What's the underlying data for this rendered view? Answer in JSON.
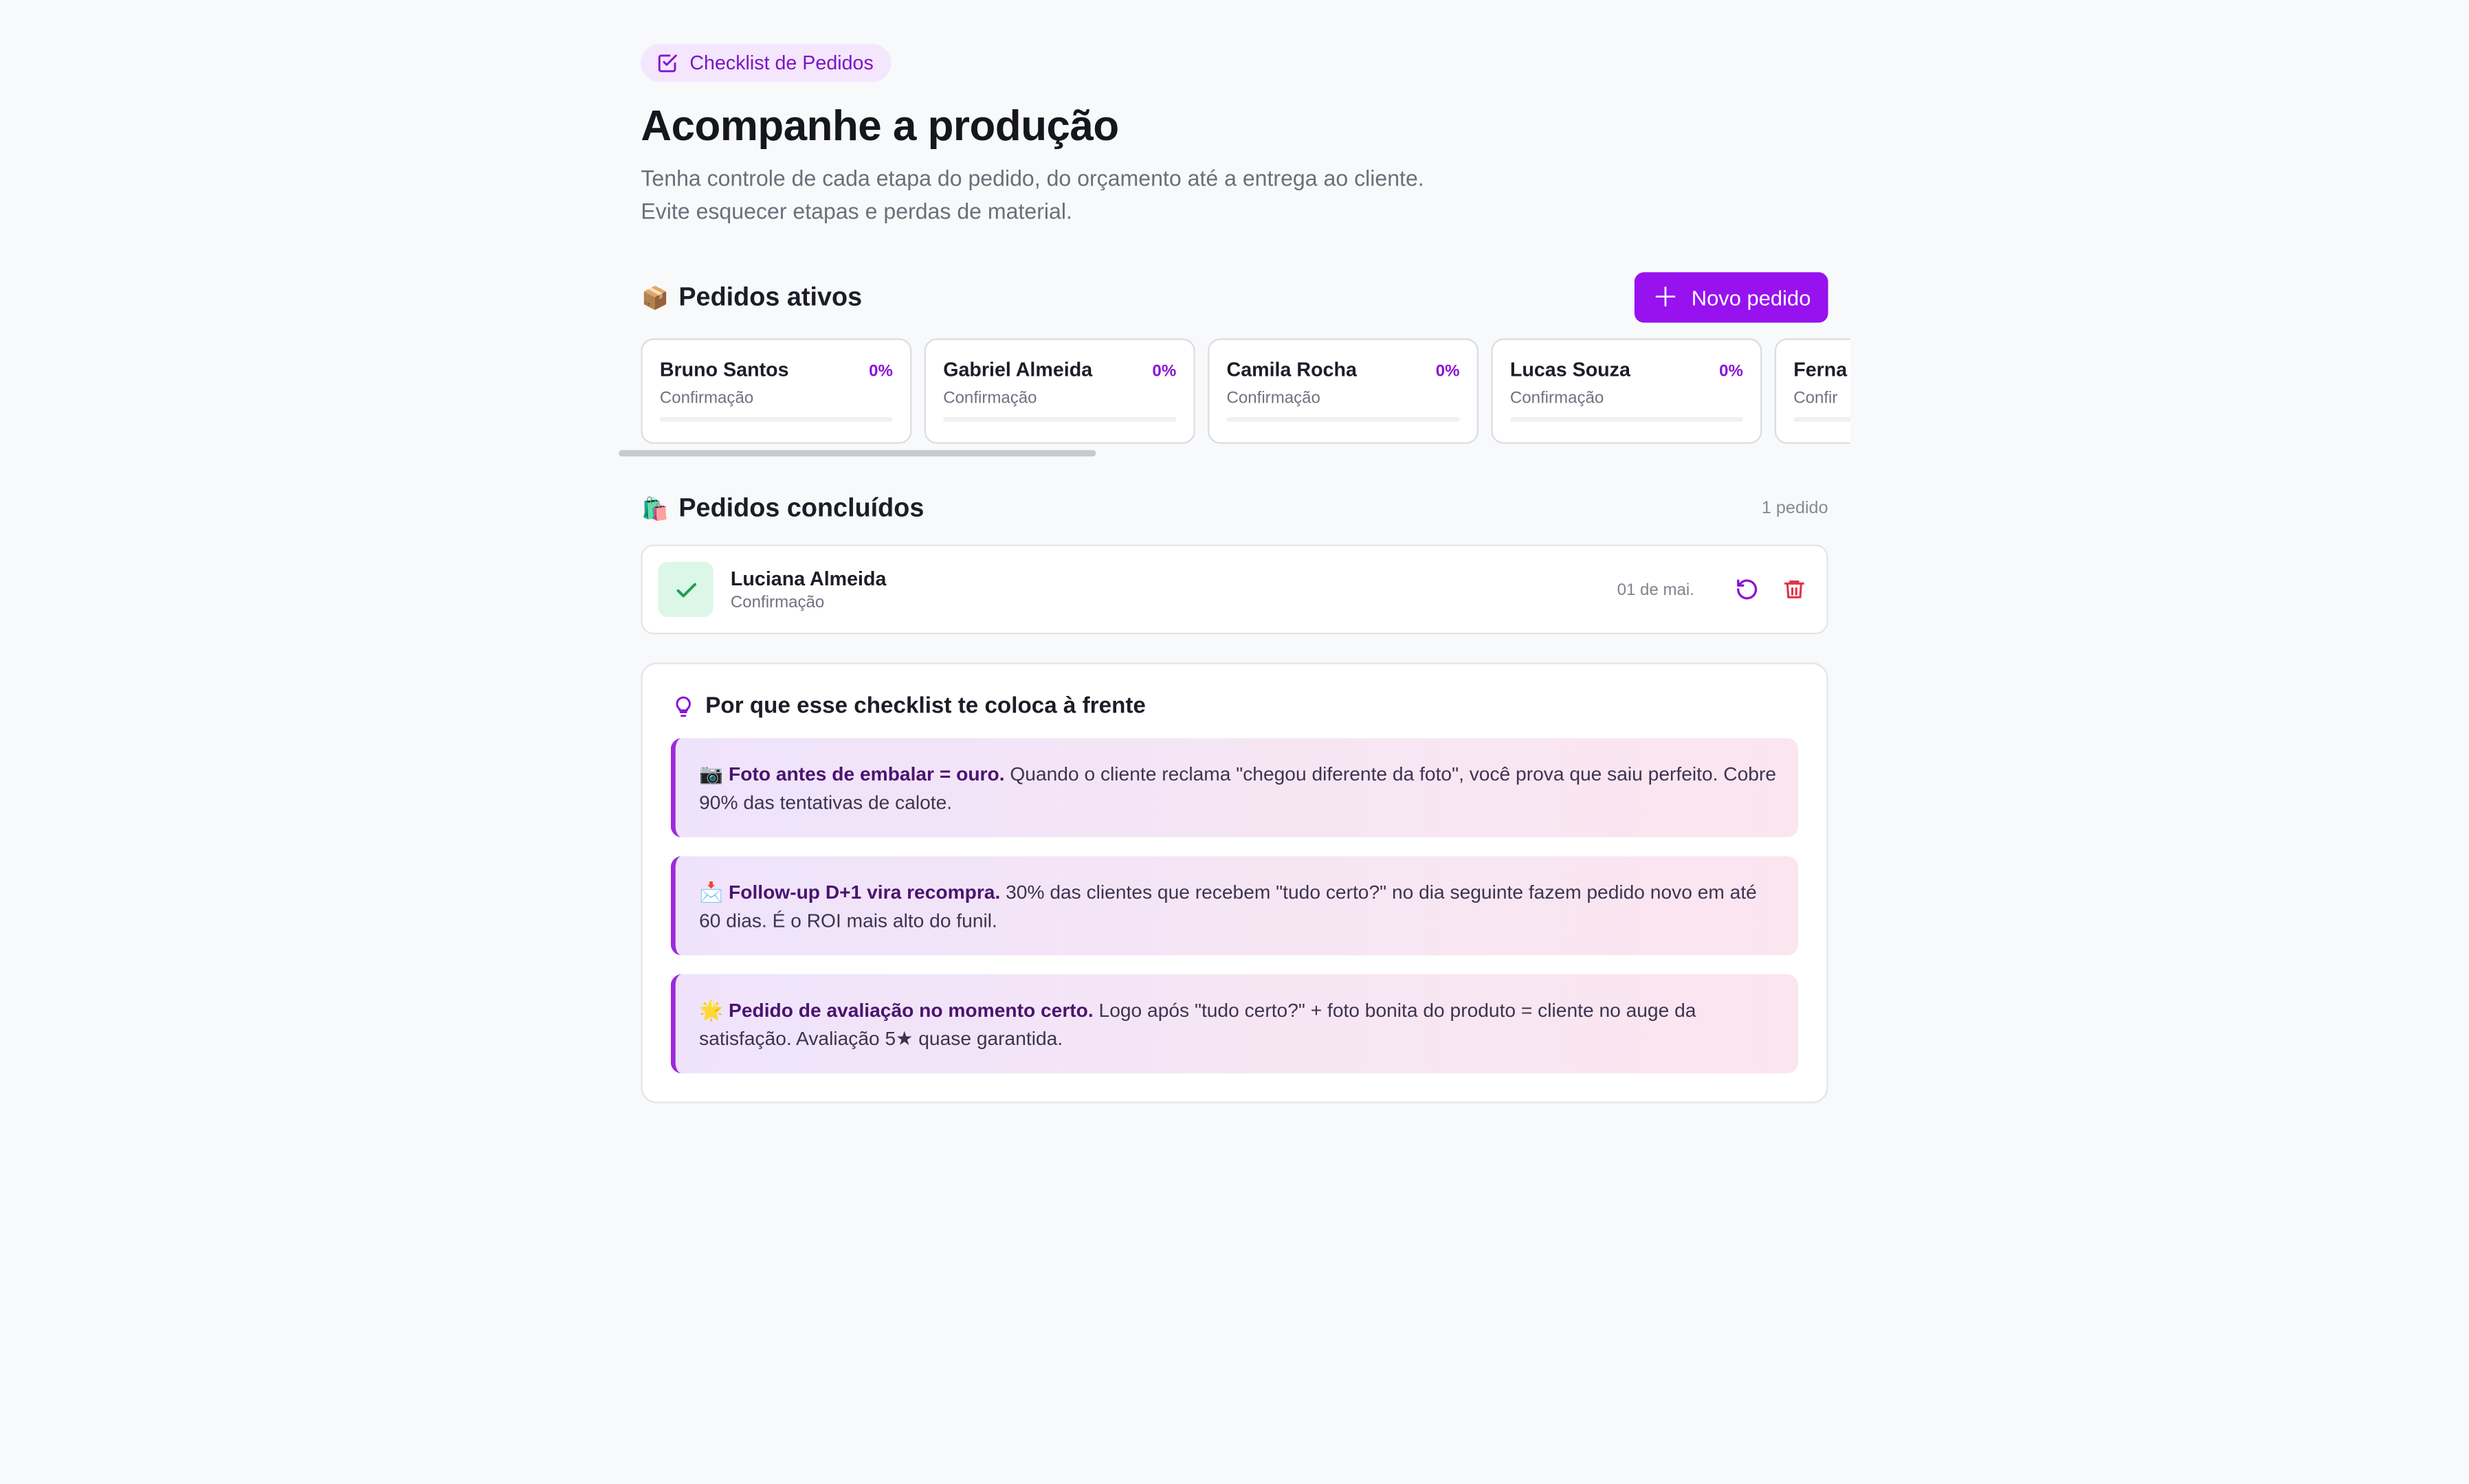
{
  "header": {
    "badge": "Checklist de Pedidos",
    "title": "Acompanhe a produção",
    "subtitle_line1": "Tenha controle de cada etapa do pedido, do orçamento até a entrega ao cliente.",
    "subtitle_line2": "Evite esquecer etapas e perdas de material."
  },
  "active": {
    "emoji": "📦",
    "title": "Pedidos ativos",
    "new_button": "Novo pedido",
    "orders": [
      {
        "name": "Bruno Santos",
        "percent": "0%",
        "stage": "Confirmação",
        "progress": 0
      },
      {
        "name": "Gabriel Almeida",
        "percent": "0%",
        "stage": "Confirmação",
        "progress": 0
      },
      {
        "name": "Camila Rocha",
        "percent": "0%",
        "stage": "Confirmação",
        "progress": 0
      },
      {
        "name": "Lucas Souza",
        "percent": "0%",
        "stage": "Confirmação",
        "progress": 0
      },
      {
        "name": "Ferna",
        "percent": "",
        "stage": "Confir",
        "progress": 0
      }
    ]
  },
  "completed": {
    "emoji": "🛍️",
    "title": "Pedidos concluídos",
    "count": "1 pedido",
    "items": [
      {
        "name": "Luciana Almeida",
        "stage": "Confirmação",
        "date": "01 de mai."
      }
    ]
  },
  "tips": {
    "title": "Por que esse checklist te coloca à frente",
    "items": [
      {
        "emoji": "📷",
        "bold": "Foto antes de embalar = ouro.",
        "text": " Quando o cliente reclama \"chegou diferente da foto\", você prova que saiu perfeito. Cobre 90% das tentativas de calote."
      },
      {
        "emoji": "📩",
        "bold": "Follow-up D+1 vira recompra.",
        "text": " 30% das clientes que recebem \"tudo certo?\" no dia seguinte fazem pedido novo em até 60 dias. É o ROI mais alto do funil."
      },
      {
        "emoji": "🌟",
        "bold": "Pedido de avaliação no momento certo.",
        "text": " Logo após \"tudo certo?\" + foto bonita do produto = cliente no auge da satisfação. Avaliação 5★ quase garantida."
      }
    ]
  },
  "colors": {
    "accent": "#9712ef",
    "success_bg": "#dcf6e8",
    "success": "#1f9d57",
    "danger": "#e0344b"
  },
  "icons": [
    "checklist-icon",
    "plus-icon",
    "check-icon",
    "undo-icon",
    "trash-icon",
    "lightbulb-icon"
  ]
}
